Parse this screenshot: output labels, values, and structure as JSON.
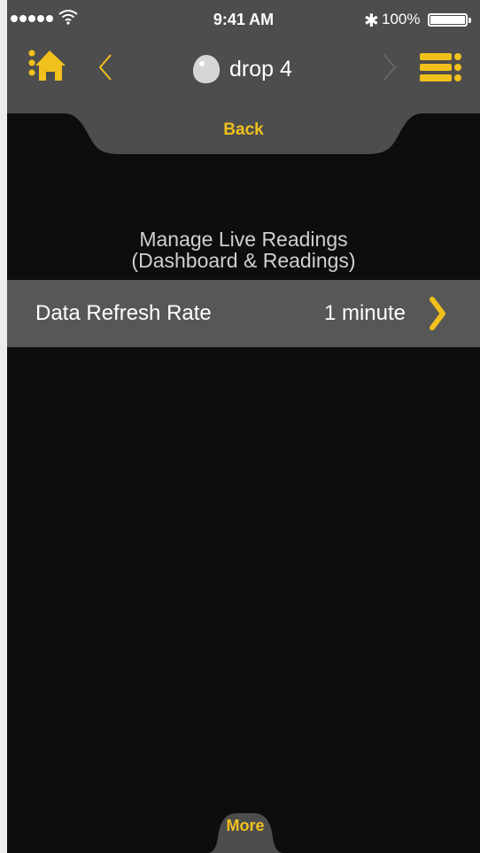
{
  "status_bar": {
    "time": "9:41 AM",
    "bluetooth": "✱",
    "battery_percent": "100%",
    "signal_icon": "signal-dots-icon",
    "wifi_icon": "wifi-icon",
    "battery_level": 1.0
  },
  "nav": {
    "title": "drop 4",
    "home_icon": "home-icon",
    "prev_icon": "chevron-left-icon",
    "next_icon": "chevron-right-icon",
    "menu_icon": "list-menu-icon",
    "device_icon": "drop-device-icon"
  },
  "back_tab": {
    "label": "Back"
  },
  "section": {
    "heading_line1": "Manage Live Readings",
    "heading_line2": "(Dashboard & Readings)"
  },
  "settings": [
    {
      "label": "Data Refresh Rate",
      "value": "1 minute"
    }
  ],
  "more_tab": {
    "label": "More"
  },
  "colors": {
    "accent": "#f0c01c",
    "bar_background": "#4d4d4d",
    "row_background": "#575757",
    "screen_background": "#0d0d0c"
  }
}
